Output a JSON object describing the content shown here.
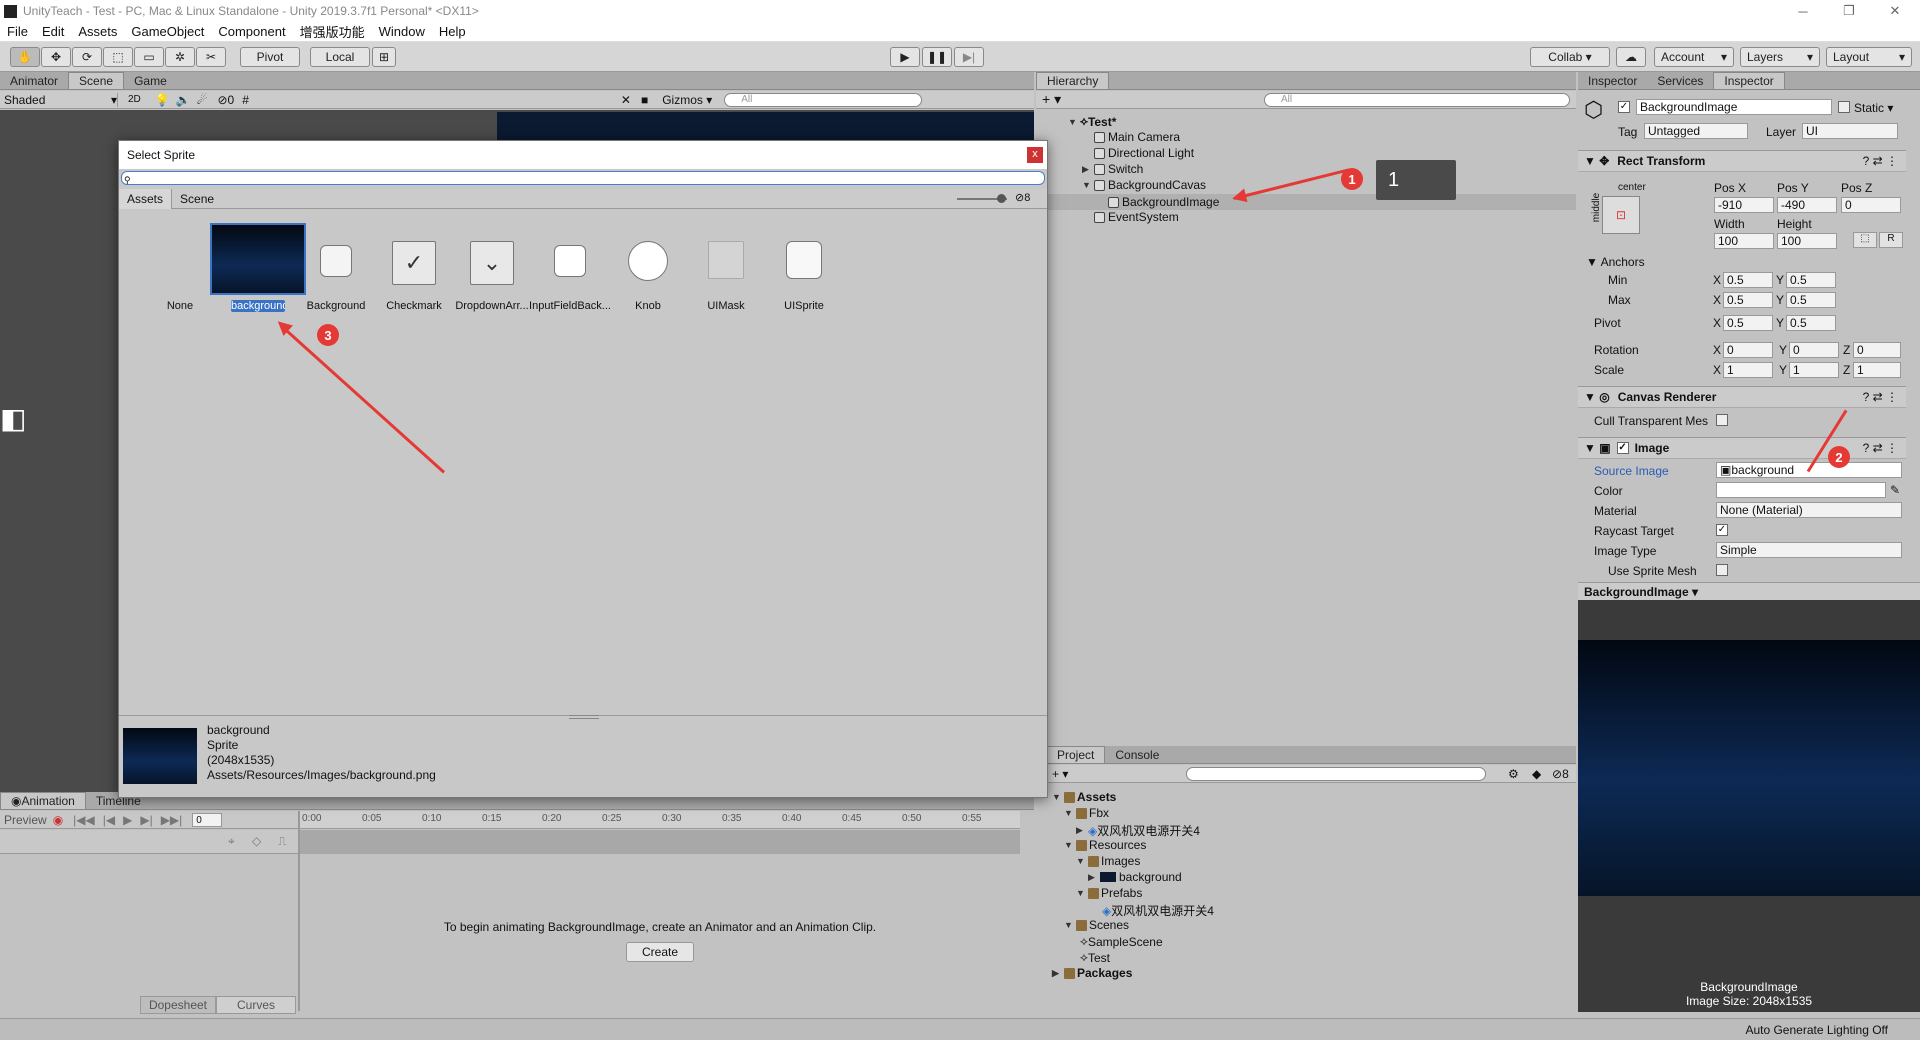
{
  "window": {
    "title": "UnityTeach - Test - PC, Mac & Linux Standalone - Unity 2019.3.7f1 Personal* <DX11>"
  },
  "menu": [
    "File",
    "Edit",
    "Assets",
    "GameObject",
    "Component",
    "增强版功能",
    "Window",
    "Help"
  ],
  "toolbar": {
    "pivot": "Pivot",
    "local": "Local",
    "collab": "Collab ▾",
    "account": "Account",
    "layers": "Layers",
    "layout": "Layout"
  },
  "scene_panel": {
    "tabs": [
      "Animator",
      "Scene",
      "Game"
    ],
    "shading": "Shaded",
    "mode_2d": "2D",
    "fx_count": "0",
    "gizmos": "Gizmos",
    "search_placeholder": "All"
  },
  "hierarchy": {
    "tab": "Hierarchy",
    "search_placeholder": "All",
    "items": [
      "Test*",
      "Main Camera",
      "Directional Light",
      "Switch",
      "BackgroundCavas",
      "BackgroundImage",
      "EventSystem"
    ]
  },
  "inspector": {
    "tabs": [
      "Inspector",
      "Services",
      "Inspector"
    ],
    "object_name": "BackgroundImage",
    "static_label": "Static",
    "tag_label": "Tag",
    "tag_value": "Untagged",
    "layer_label": "Layer",
    "layer_value": "UI",
    "rect_transform": {
      "title": "Rect Transform",
      "anchor_top": "center",
      "anchor_side": "middle",
      "posx_label": "Pos X",
      "posy_label": "Pos Y",
      "posz_label": "Pos Z",
      "posx": "-910",
      "posy": "-490",
      "posz": "0",
      "width_label": "Width",
      "height_label": "Height",
      "width": "100",
      "height": "100",
      "r_btn": "R",
      "anchors": "Anchors",
      "min": "Min",
      "max": "Max",
      "pivot": "Pivot",
      "min_x": "0.5",
      "min_y": "0.5",
      "max_x": "0.5",
      "max_y": "0.5",
      "pivot_x": "0.5",
      "pivot_y": "0.5",
      "rotation": "Rotation",
      "rot_x": "0",
      "rot_y": "0",
      "rot_z": "0",
      "scale": "Scale",
      "scale_x": "1",
      "scale_y": "1",
      "scale_z": "1",
      "x": "X",
      "y": "Y",
      "z": "Z"
    },
    "canvas_renderer": {
      "title": "Canvas Renderer",
      "cull": "Cull Transparent Mes"
    },
    "image": {
      "title": "Image",
      "source_label": "Source Image",
      "source_value": "background",
      "color_label": "Color",
      "material_label": "Material",
      "material_value": "None (Material)",
      "raycast_label": "Raycast Target",
      "type_label": "Image Type",
      "type_value": "Simple",
      "sprite_mesh_label": "Use Sprite Mesh"
    },
    "preview": {
      "header": "BackgroundImage",
      "caption1": "BackgroundImage",
      "caption2": "Image Size: 2048x1535"
    }
  },
  "project": {
    "tabs": [
      "Project",
      "Console"
    ],
    "hidden_count": "8",
    "tree": [
      "Assets",
      "Fbx",
      "双风机双电源开关4",
      "Resources",
      "Images",
      "background",
      "Prefabs",
      "双风机双电源开关4",
      "Scenes",
      "SampleScene",
      "Test",
      "Packages"
    ]
  },
  "animation": {
    "tabs": [
      "Animation",
      "Timeline"
    ],
    "preview": "Preview",
    "frame": "0",
    "ticks": [
      "0:00",
      "0:05",
      "0:10",
      "0:15",
      "0:20",
      "0:25",
      "0:30",
      "0:35",
      "0:40",
      "0:45",
      "0:50",
      "0:55"
    ],
    "message": "To begin animating BackgroundImage, create an Animator and an Animation Clip.",
    "create": "Create",
    "dopesheet": "Dopesheet",
    "curves": "Curves"
  },
  "dialog": {
    "title": "Select Sprite",
    "close": "x",
    "tabs": [
      "Assets",
      "Scene"
    ],
    "hidden_count": "8",
    "items": [
      "None",
      "background",
      "Background",
      "Checkmark",
      "DropdownArr...",
      "InputFieldBack...",
      "Knob",
      "UIMask",
      "UISprite"
    ],
    "info": {
      "name": "background",
      "type": "Sprite",
      "size": "(2048x1535)",
      "path": "Assets/Resources/Images/background.png"
    }
  },
  "callouts": {
    "badge1": "1",
    "badge2": "2",
    "badge3": "3",
    "tooltip": "1"
  },
  "statusbar": {
    "text": "Auto Generate Lighting Off"
  },
  "colors": {
    "accent_red": "#e53935",
    "selection": "#3a72c4",
    "dark_blue": "#0a1a33"
  }
}
